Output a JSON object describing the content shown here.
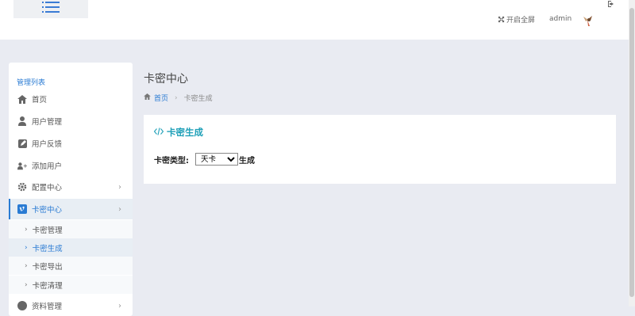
{
  "header": {
    "fullscreen_label": "开启全屏",
    "user_name": "admin"
  },
  "sidebar": {
    "title": "管理列表",
    "items": [
      {
        "label": "首页",
        "icon": "home-icon"
      },
      {
        "label": "用户管理",
        "icon": "user-icon"
      },
      {
        "label": "用户反馈",
        "icon": "edit-icon"
      },
      {
        "label": "添加用户",
        "icon": "user-plus-icon"
      },
      {
        "label": "配置中心",
        "icon": "gear-icon"
      },
      {
        "label": "卡密中心",
        "icon": "vimeo-square-icon"
      }
    ],
    "sub_items": [
      {
        "label": "卡密管理"
      },
      {
        "label": "卡密生成"
      },
      {
        "label": "卡密导出"
      },
      {
        "label": "卡密清理"
      }
    ],
    "next_item": {
      "label": "资料管理"
    }
  },
  "main": {
    "page_title": "卡密中心",
    "breadcrumb": {
      "home": "首页",
      "current": "卡密生成"
    },
    "card": {
      "title": "卡密生成",
      "type_label": "卡密类型:",
      "type_selected": "天卡",
      "generate_label": "生成"
    }
  },
  "colors": {
    "accent": "#2a7bd3",
    "card_title": "#1fa0b8",
    "background": "#e9ebf2"
  }
}
